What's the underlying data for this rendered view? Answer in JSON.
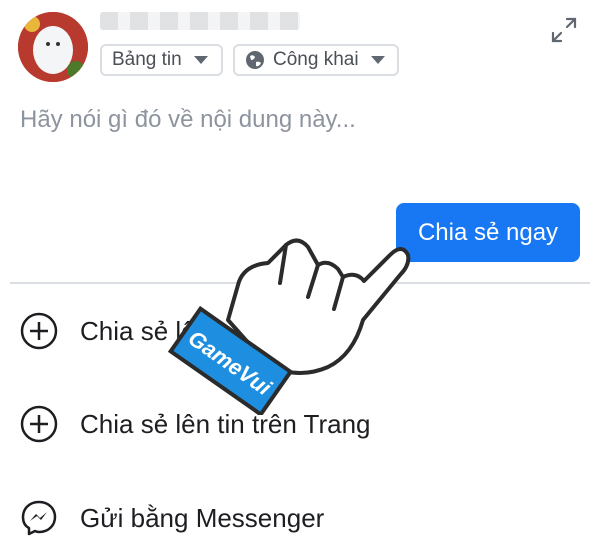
{
  "composer": {
    "audience_feed": "Bảng tin",
    "audience_privacy": "Công khai",
    "placeholder": "Hãy nói gì đó về nội dung này...",
    "share_now": "Chia sẻ ngay"
  },
  "options": [
    {
      "label": "Chia sẻ lê",
      "icon": "plus-circle-icon"
    },
    {
      "label": "Chia sẻ lên tin trên Trang",
      "icon": "plus-circle-icon"
    },
    {
      "label": "Gửi bằng Messenger",
      "icon": "messenger-icon"
    }
  ],
  "overlay": {
    "watermark": "GameVui",
    "hand_icon": "pointing-hand-icon"
  },
  "colors": {
    "primary": "#1877f2",
    "watermark_band": "#1e8fe0",
    "text": "#1c1e21",
    "muted": "#8d949e"
  }
}
